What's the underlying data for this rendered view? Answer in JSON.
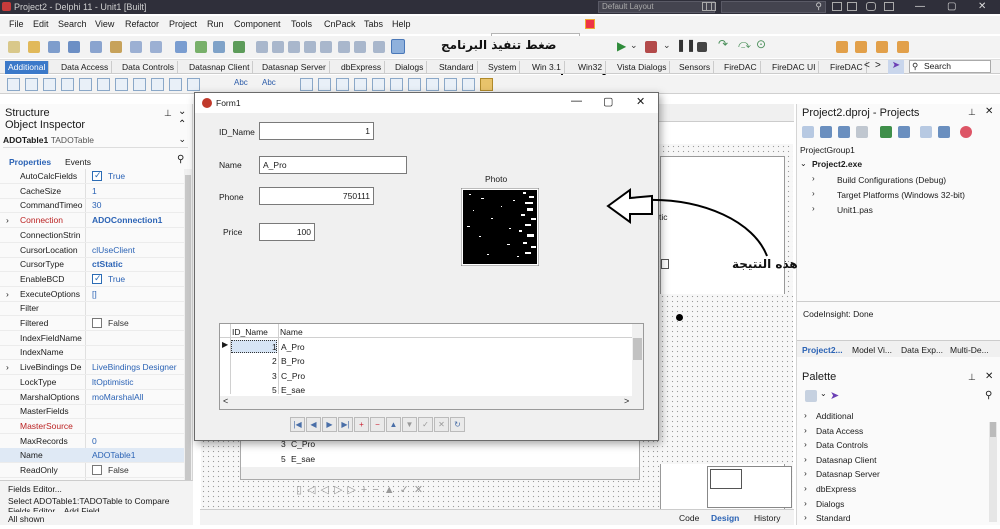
{
  "window": {
    "title": "Project2 - Delphi 11 - Unit1 [Built]",
    "layout": "Default Layout",
    "controls": [
      "—",
      "▢",
      "✕"
    ]
  },
  "menu": [
    "File",
    "Edit",
    "Search",
    "View",
    "Refactor",
    "Project",
    "Run",
    "Component",
    "Tools",
    "CnPack",
    "Tabs",
    "Help"
  ],
  "palette_tabs": [
    "Additional",
    "Data Access",
    "Data Controls",
    "Datasnap Client",
    "Datasnap Server",
    "dbExpress",
    "Dialogs",
    "Standard",
    "System",
    "Win 3.1",
    "Win32",
    "Vista Dialogs",
    "Sensors",
    "FireDAC",
    "FireDAC UI",
    "FireDAC"
  ],
  "palette_search": "Search",
  "annotations": {
    "run_note": "ضغط تنفيذ البرنامج",
    "result_note": "هذه النتيجة"
  },
  "structure": {
    "title": "Structure",
    "inspector_title": "Object Inspector",
    "object": "ADOTable1",
    "object_type": "TADOTable",
    "tabs": [
      "Properties",
      "Events"
    ]
  },
  "properties": [
    {
      "name": "AutoCalcFields",
      "value": "True",
      "check": true
    },
    {
      "name": "CacheSize",
      "value": "1"
    },
    {
      "name": "CommandTimeo",
      "value": "30"
    },
    {
      "name": "Connection",
      "value": "ADOConnection1",
      "expand": true,
      "red": true,
      "bold": true
    },
    {
      "name": "ConnectionStrin",
      "value": ""
    },
    {
      "name": "CursorLocation",
      "value": "clUseClient"
    },
    {
      "name": "CursorType",
      "value": "ctStatic",
      "bold": true
    },
    {
      "name": "EnableBCD",
      "value": "True",
      "check": true
    },
    {
      "name": "ExecuteOptions",
      "value": "[]",
      "expand": true
    },
    {
      "name": "Filter",
      "value": ""
    },
    {
      "name": "Filtered",
      "value": "False",
      "check": false
    },
    {
      "name": "IndexFieldName",
      "value": ""
    },
    {
      "name": "IndexName",
      "value": ""
    },
    {
      "name": "LiveBindings De",
      "value": "LiveBindings Designer",
      "expand": true
    },
    {
      "name": "LockType",
      "value": "ltOptimistic"
    },
    {
      "name": "MarshalOptions",
      "value": "moMarshalAll"
    },
    {
      "name": "MasterFields",
      "value": ""
    },
    {
      "name": "MasterSource",
      "value": "",
      "red": true
    },
    {
      "name": "MaxRecords",
      "value": "0"
    },
    {
      "name": "Name",
      "value": "ADOTable1",
      "selected": true
    },
    {
      "name": "ReadOnly",
      "value": "False",
      "check": false
    }
  ],
  "inspector_footer": {
    "link": "Fields Editor...",
    "hint1": "Select ADOTable1:TADOTable to Compare",
    "hint2": "Fields Editor... Add Field",
    "status": "All shown"
  },
  "form1": {
    "title": "Form1",
    "labels": {
      "id": "ID_Name",
      "name": "Name",
      "phone": "Phone",
      "price": "Price",
      "photo": "Photo"
    },
    "values": {
      "id": "1",
      "name": "A_Pro",
      "phone": "750111",
      "price": "100"
    },
    "grid": {
      "columns": [
        "ID_Name",
        "Name"
      ],
      "rows": [
        [
          "1",
          "A_Pro"
        ],
        [
          "2",
          "B_Pro"
        ],
        [
          "3",
          "C_Pro"
        ],
        [
          "5",
          "E_sae"
        ]
      ]
    },
    "navigator": [
      "|◀",
      "◀",
      "▶",
      "▶|",
      "+",
      "−",
      "▲",
      "▼",
      "✓",
      "✕",
      "↻"
    ]
  },
  "designer": {
    "rows": [
      [
        "3",
        "C_Pro"
      ],
      [
        "5",
        "E_sae"
      ]
    ],
    "tabs": [
      "Code",
      "Design",
      "History"
    ],
    "stic": "tic"
  },
  "projects": {
    "title": "Project2.dproj - Projects",
    "items": [
      "ProjectGroup1",
      "Project2.exe",
      "Build Configurations (Debug)",
      "Target Platforms (Windows 32-bit)",
      "Unit1.pas"
    ],
    "status": "CodeInsight: Done",
    "tabs": [
      "Project2...",
      "Model Vi...",
      "Data Exp...",
      "Multi-De..."
    ]
  },
  "palette": {
    "title": "Palette",
    "items": [
      "Additional",
      "Data Access",
      "Data Controls",
      "Datasnap Client",
      "Datasnap Server",
      "dbExpress",
      "Dialogs",
      "Standard"
    ]
  }
}
